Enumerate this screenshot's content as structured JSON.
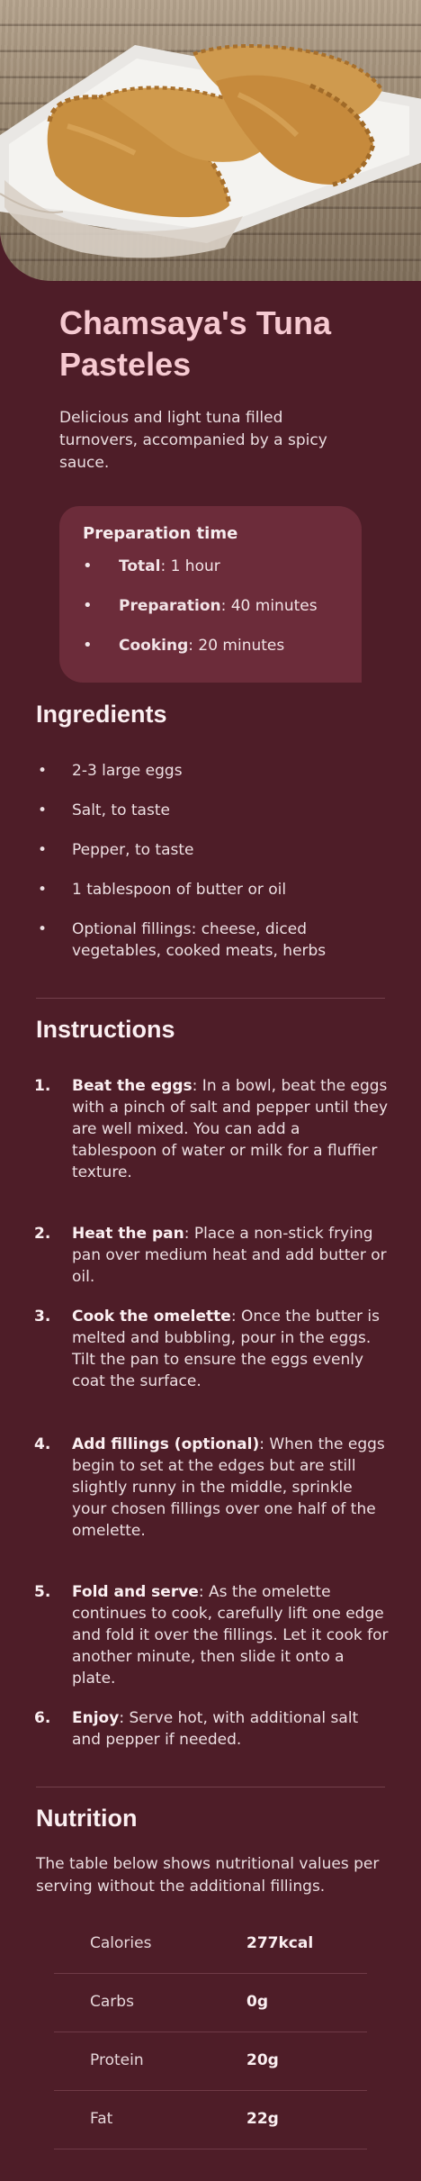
{
  "recipe": {
    "title": "Chamsaya's Tuna Pasteles",
    "description": "Delicious and light tuna filled turnovers, accompanied by a spicy sauce."
  },
  "preparation": {
    "heading": "Preparation time",
    "items": [
      {
        "label": "Total",
        "value": ": 1 hour"
      },
      {
        "label": "Preparation",
        "value": ": 40 minutes"
      },
      {
        "label": "Cooking",
        "value": ": 20 minutes"
      }
    ]
  },
  "ingredients": {
    "heading": "Ingredients",
    "items": [
      "2-3 large eggs",
      "Salt, to taste",
      "Pepper, to taste",
      "1 tablespoon of butter or oil",
      "Optional fillings: cheese, diced vegetables, cooked meats, herbs"
    ]
  },
  "instructions": {
    "heading": "Instructions",
    "steps": [
      {
        "num": "1.",
        "lead": "Beat the eggs",
        "text": ": In a bowl, beat the eggs with a pinch of salt and pepper until they are well mixed. You can add a tablespoon of water or milk for a fluffier texture."
      },
      {
        "num": "2.",
        "lead": "Heat the pan",
        "text": ": Place a non-stick frying pan over medium heat and add butter or oil."
      },
      {
        "num": "3.",
        "lead": "Cook the omelette",
        "text": ": Once the butter is melted and bubbling, pour in the eggs. Tilt the pan to ensure the eggs evenly coat the surface."
      },
      {
        "num": "4.",
        "lead": "Add fillings (optional)",
        "text": ": When the eggs begin to set at the edges but are still slightly runny in the middle, sprinkle your chosen fillings over one half of the omelette."
      },
      {
        "num": "5.",
        "lead": "Fold and serve",
        "text": ": As the omelette continues to cook, carefully lift one edge and fold it over the fillings. Let it cook for another minute, then slide it onto a plate."
      },
      {
        "num": "6.",
        "lead": "Enjoy",
        "text": ": Serve hot, with additional salt and pepper if needed."
      }
    ]
  },
  "nutrition": {
    "heading": "Nutrition",
    "intro": "The table below shows nutritional values per serving without the additional fillings.",
    "rows": [
      {
        "label": "Calories",
        "value": "277kcal"
      },
      {
        "label": "Carbs",
        "value": "0g"
      },
      {
        "label": "Protein",
        "value": "20g"
      },
      {
        "label": "Fat",
        "value": "22g"
      }
    ]
  },
  "colors": {
    "background": "#4e1d28",
    "card": "#6c2c3a",
    "title": "#f6c9d1"
  }
}
